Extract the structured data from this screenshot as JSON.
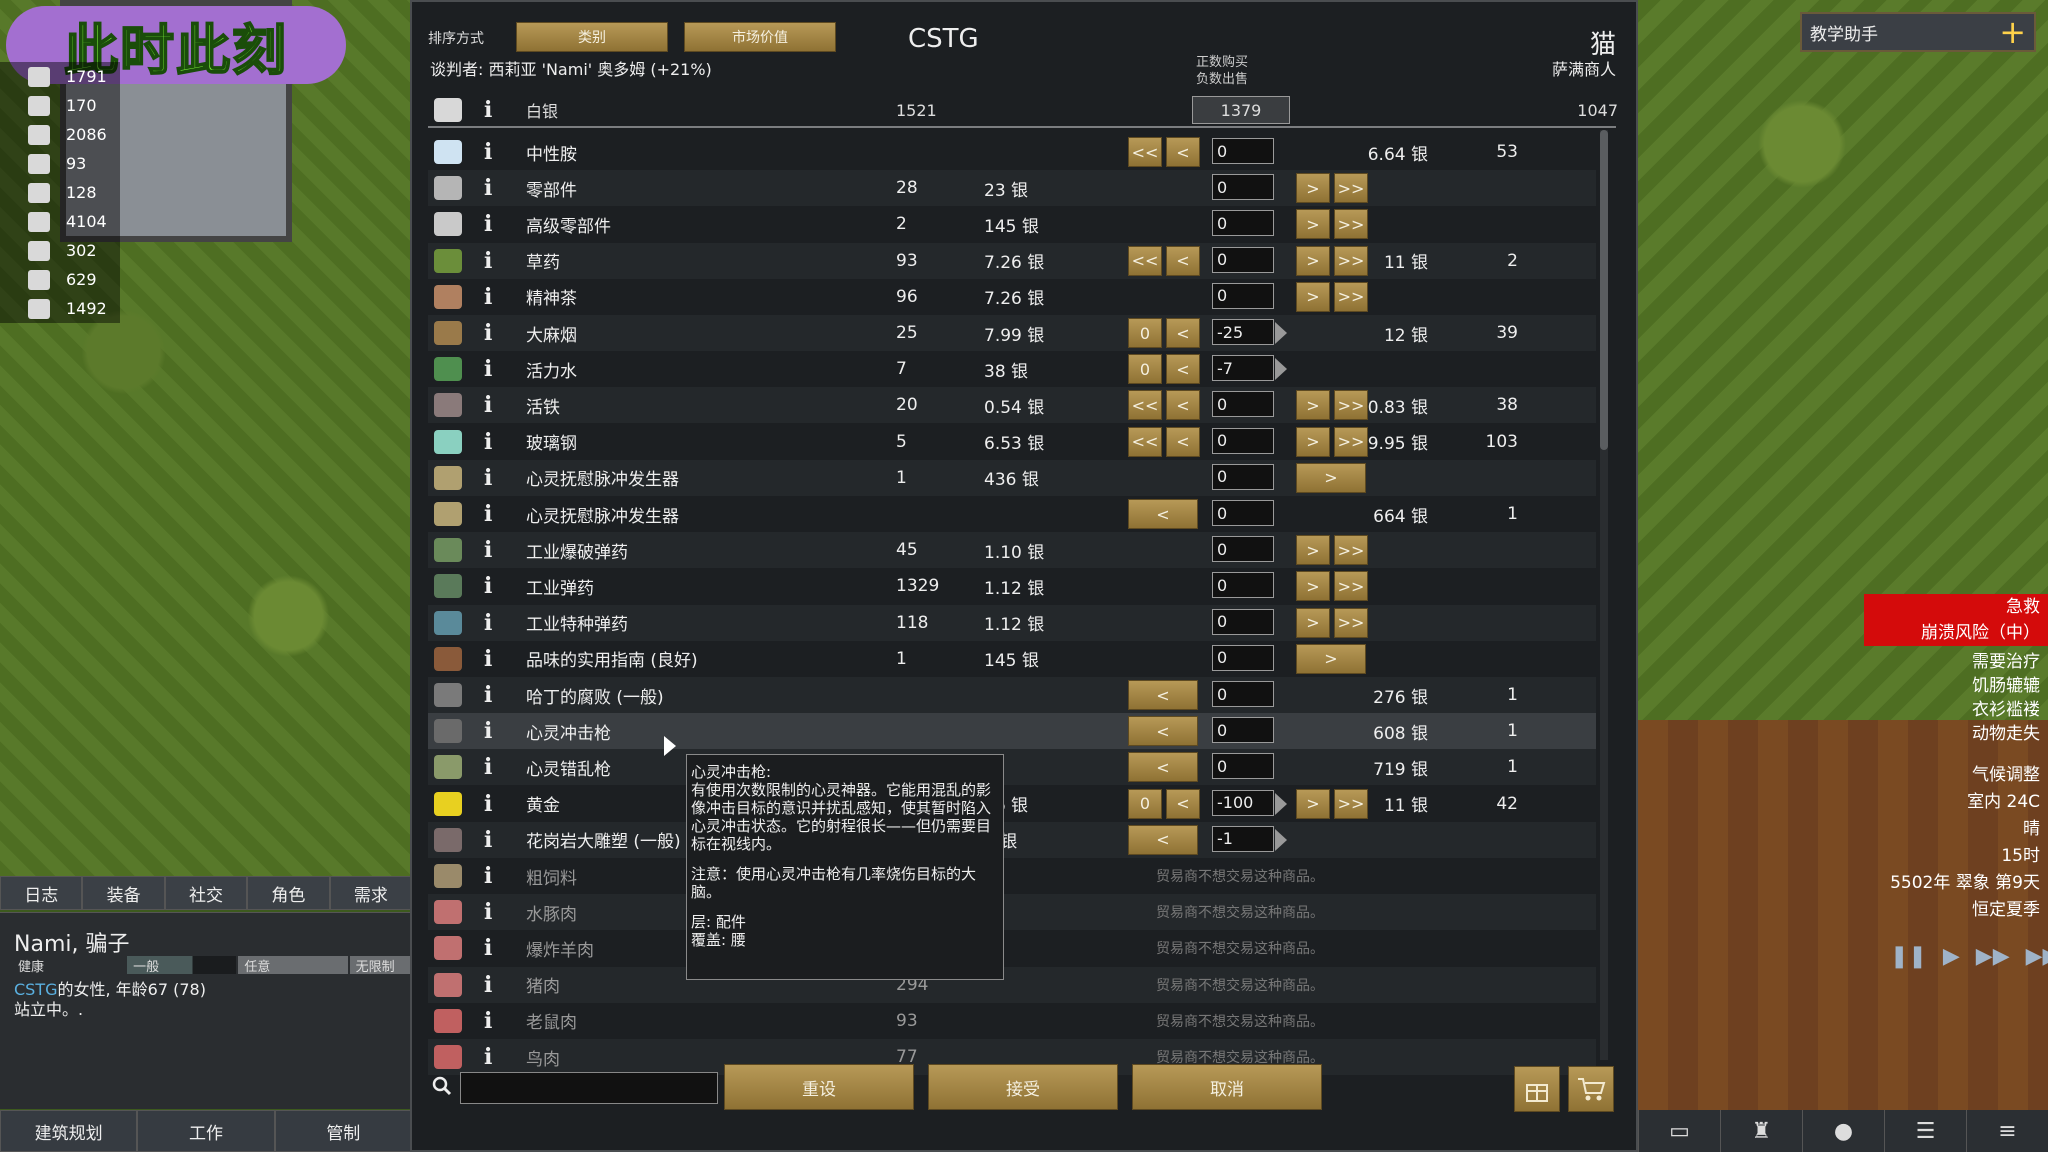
{
  "overlay": {
    "stream_title": "此时此刻"
  },
  "resources": [
    {
      "icon": "meal-icon",
      "value": "1791"
    },
    {
      "icon": "wrench-icon",
      "value": "170"
    },
    {
      "icon": "wood-icon",
      "value": "2086"
    },
    {
      "icon": "medicine-icon",
      "value": "93"
    },
    {
      "icon": "pill-icon",
      "value": "128"
    },
    {
      "icon": "steel-icon",
      "value": "4104"
    },
    {
      "icon": "herb-icon",
      "value": "302"
    },
    {
      "icon": "component-icon",
      "value": "629"
    },
    {
      "icon": "crate-icon",
      "value": "1492"
    }
  ],
  "left_tabs": [
    "日志",
    "装备",
    "社交",
    "角色",
    "需求"
  ],
  "pawn": {
    "name": "Nami, 骗子",
    "bars": [
      "健康",
      "一般",
      "任意",
      "无限制"
    ],
    "faction": "CSTG",
    "desc": "的女性, 年龄67 (78)",
    "status": "站立中。."
  },
  "arch_tabs": [
    "建筑规划",
    "工作",
    "管制"
  ],
  "trade": {
    "sort_label": "排序方式",
    "sort_category": "类别",
    "sort_value": "市场价值",
    "negotiator": "谈判者: 西莉亚 'Nami' 奥多姆 (+21%)",
    "colony": "CSTG",
    "trader": "猫",
    "trader_kind": "萨满商人",
    "buy_label": "正数购买",
    "sell_label": "负数出售",
    "silver": {
      "name": "白银",
      "have": "1521",
      "qty": "1379",
      "trader_have": "1047"
    },
    "rows": [
      {
        "icon": "#cfe3f2",
        "name": "中性胺",
        "have": "",
        "price_l": "",
        "left": [
          "<<",
          "<"
        ],
        "qty": "0",
        "right": [],
        "price_r": "6.64 银",
        "count": "53"
      },
      {
        "icon": "#b5b5b5",
        "name": "零部件",
        "have": "28",
        "price_l": "23 银",
        "left": [],
        "qty": "0",
        "right": [
          ">",
          ">>"
        ],
        "price_r": "",
        "count": ""
      },
      {
        "icon": "#c9c9c9",
        "name": "高级零部件",
        "have": "2",
        "price_l": "145 银",
        "left": [],
        "qty": "0",
        "right": [
          ">",
          ">>"
        ],
        "price_r": "",
        "count": ""
      },
      {
        "icon": "#6b8e3a",
        "name": "草药",
        "have": "93",
        "price_l": "7.26 银",
        "left": [
          "<<",
          "<"
        ],
        "qty": "0",
        "right": [
          ">",
          ">>"
        ],
        "price_r": "11 银",
        "count": "2"
      },
      {
        "icon": "#b08060",
        "name": "精神茶",
        "have": "96",
        "price_l": "7.26 银",
        "left": [],
        "qty": "0",
        "right": [
          ">",
          ">>"
        ],
        "price_r": "",
        "count": ""
      },
      {
        "icon": "#9a7a4a",
        "name": "大麻烟",
        "have": "25",
        "price_l": "7.99 银",
        "left": [
          "0",
          "<"
        ],
        "qty": "-25",
        "arrow": true,
        "right": [],
        "price_r": "12 银",
        "count": "39"
      },
      {
        "icon": "#4f8f4f",
        "name": "活力水",
        "have": "7",
        "price_l": "38 银",
        "left": [
          "0",
          "<"
        ],
        "qty": "-7",
        "arrow": true,
        "right": [],
        "price_r": "",
        "count": ""
      },
      {
        "icon": "#8a7a7a",
        "name": "活铁",
        "have": "20",
        "price_l": "0.54 银",
        "left": [
          "<<",
          "<"
        ],
        "qty": "0",
        "right": [
          ">",
          ">>"
        ],
        "price_r": "0.83 银",
        "count": "38"
      },
      {
        "icon": "#8ad0c0",
        "name": "玻璃钢",
        "have": "5",
        "price_l": "6.53 银",
        "left": [
          "<<",
          "<"
        ],
        "qty": "0",
        "right": [
          ">",
          ">>"
        ],
        "price_r": "9.95 银",
        "count": "103"
      },
      {
        "icon": "#b0a070",
        "name": "心灵抚慰脉冲发生器",
        "have": "1",
        "price_l": "436 银",
        "left": [],
        "qty": "0",
        "right": [
          ">"
        ],
        "price_r": "",
        "count": ""
      },
      {
        "icon": "#b0a070",
        "name": "心灵抚慰脉冲发生器",
        "have": "",
        "price_l": "",
        "left": [
          "<"
        ],
        "qty": "0",
        "right": [],
        "price_r": "664 银",
        "count": "1"
      },
      {
        "icon": "#6a8a5a",
        "name": "工业爆破弹药",
        "have": "45",
        "price_l": "1.10 银",
        "left": [],
        "qty": "0",
        "right": [
          ">",
          ">>"
        ],
        "price_r": "",
        "count": ""
      },
      {
        "icon": "#5a7a5a",
        "name": "工业弹药",
        "have": "1329",
        "price_l": "1.12 银",
        "left": [],
        "qty": "0",
        "right": [
          ">",
          ">>"
        ],
        "price_r": "",
        "count": ""
      },
      {
        "icon": "#5a8a9a",
        "name": "工业特种弹药",
        "have": "118",
        "price_l": "1.12 银",
        "left": [],
        "qty": "0",
        "right": [
          ">",
          ">>"
        ],
        "price_r": "",
        "count": ""
      },
      {
        "icon": "#8a5a3a",
        "name": "品味的实用指南 (良好)",
        "have": "1",
        "price_l": "145 银",
        "left": [],
        "qty": "0",
        "right": [
          ">"
        ],
        "price_r": "",
        "count": ""
      },
      {
        "icon": "#7a7a7a",
        "name": "哈丁的腐败 (一般)",
        "have": "",
        "price_l": "",
        "left": [
          "<"
        ],
        "qty": "0",
        "right": [],
        "price_r": "276 银",
        "count": "1"
      },
      {
        "icon": "#6a6a6a",
        "name": "心灵冲击枪",
        "have": "",
        "price_l": "",
        "left": [
          "<"
        ],
        "qty": "0",
        "right": [],
        "price_r": "608 银",
        "count": "1",
        "hl": true
      },
      {
        "icon": "#8a9a6a",
        "name": "心灵错乱枪",
        "have": "",
        "price_l": "",
        "left": [
          "<"
        ],
        "qty": "0",
        "right": [],
        "price_r": "719 银",
        "count": "1"
      },
      {
        "icon": "#e8d020",
        "name": "黄金",
        "have": "",
        "price_l": "26 银",
        "left": [
          "0",
          "<"
        ],
        "qty": "-100",
        "arrow": true,
        "right": [
          ">",
          ">>"
        ],
        "price_r": "11 银",
        "count": "42"
      },
      {
        "icon": "#7a6a6a",
        "name": "花岗岩大雕塑 (一般)",
        "have": "",
        "price_l": "4 银",
        "left": [
          "<"
        ],
        "qty": "-1",
        "arrow": true,
        "right": [],
        "price_r": "",
        "count": ""
      },
      {
        "icon": "#9a8a6a",
        "name": "粗饲料",
        "have": "",
        "price_l": "",
        "refuse": "贸易商不想交易这种商品。",
        "dim": true
      },
      {
        "icon": "#c07070",
        "name": "水豚肉",
        "have": "",
        "price_l": "",
        "refuse": "贸易商不想交易这种商品。",
        "dim": true
      },
      {
        "icon": "#c07070",
        "name": "爆炸羊肉",
        "have": "",
        "price_l": "",
        "refuse": "贸易商不想交易这种商品。",
        "dim": true
      },
      {
        "icon": "#c07070",
        "name": "猪肉",
        "have": "294",
        "price_l": "",
        "refuse": "贸易商不想交易这种商品。",
        "dim": true
      },
      {
        "icon": "#c06060",
        "name": "老鼠肉",
        "have": "93",
        "price_l": "",
        "refuse": "贸易商不想交易这种商品。",
        "dim": true
      },
      {
        "icon": "#c06060",
        "name": "鸟肉",
        "have": "77",
        "price_l": "",
        "refuse": "贸易商不想交易这种商品。",
        "dim": true
      }
    ],
    "buttons": {
      "reset": "重设",
      "accept": "接受",
      "cancel": "取消"
    },
    "search_placeholder": ""
  },
  "tooltip": {
    "title": "心灵冲击枪:",
    "desc": "有使用次数限制的心灵神器。它能用混乱的影像冲击目标的意识并扰乱感知，使其暂时陷入心灵冲击状态。它的射程很长——但仍需要目标在视线内。",
    "note": "注意：使用心灵冲击枪有几率烧伤目标的大脑。",
    "layer": "层: 配件",
    "cover": "覆盖: 腰"
  },
  "right_panel": {
    "tutor": "教学助手",
    "alert_title": "急救",
    "alert_sub": "崩溃风险（中）",
    "alerts": [
      "需要治疗",
      "饥肠辘辘",
      "衣衫褴褛",
      "动物走失"
    ],
    "weather": [
      "气候调整",
      "室内 24C",
      "晴",
      "15时",
      "5502年 翠象 第9天",
      "恒定夏季"
    ]
  },
  "colors": {
    "gold_button": "#a88848",
    "alert_red": "#d40b0b",
    "dialog_bg": "#1c1f22"
  }
}
